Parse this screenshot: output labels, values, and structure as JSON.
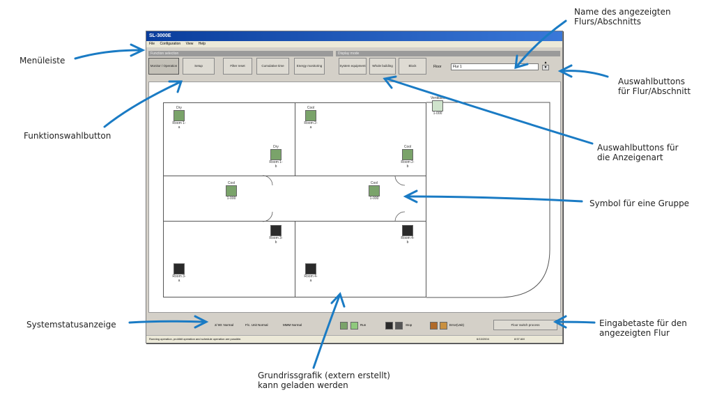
{
  "annotations": {
    "menu_bar": "Menüleiste",
    "function_button": "Funktionswahlbutton",
    "system_status": "Systemstatusanzeige",
    "floor_name_1": "Name des angezeigten",
    "floor_name_2": "Flurs/Abschnitts",
    "floor_select_1": "Auswahlbuttons",
    "floor_select_2": "für Flur/Abschnitt",
    "view_type_1": "Auswahlbuttons für",
    "view_type_2": "die Anzeigenart",
    "group_symbol": "Symbol für eine Gruppe",
    "enter_key_1": "Eingabetaste für den",
    "enter_key_2": "angezeigten Flur",
    "floorplan_1": "Grundrissgrafik (extern erstellt)",
    "floorplan_2": "kann geladen werden"
  },
  "window": {
    "title": "SL-3000E",
    "menu": [
      "File",
      "Configuration",
      "View",
      "Help"
    ],
    "group_left_header": "Function selection",
    "group_right_header": "Display mode",
    "function_buttons": [
      "Monitor / Operation",
      "Setup",
      "Filter reset",
      "Cumulative time",
      "Energy monitoring"
    ],
    "view_buttons": [
      "System equipment",
      "Whole building",
      "Block"
    ],
    "floor_label": "Floor",
    "floor_value": "Flur 1",
    "floor_spinner_up": "▲",
    "floor_spinner_down": "▼"
  },
  "units": [
    {
      "mode": "Dry",
      "label": "Room 1-a"
    },
    {
      "mode": "Cool",
      "label": "Room 2-a"
    },
    {
      "mode": "Dry",
      "label": "Room 1-b"
    },
    {
      "mode": "Cool",
      "label": "Room 2-b"
    },
    {
      "mode": "Cool",
      "label": "1-000"
    },
    {
      "mode": "Cool",
      "label": "1-000"
    },
    {
      "mode": "",
      "label": "Room 3-b"
    },
    {
      "mode": "",
      "label": "Room 4-b"
    },
    {
      "mode": "",
      "label": "Room 3-a"
    },
    {
      "mode": "",
      "label": "Room 4-a"
    },
    {
      "mode": "Ventilation",
      "label": "1-000"
    }
  ],
  "status": {
    "s1": "2/ 80: Normal",
    "s2": "F/c. Unit Normal",
    "s3": "MMM Normal",
    "run": "Run",
    "stop": "Stop",
    "error": "Error(Unit)",
    "enter_button": "Floor switch process",
    "bottom_text": "Running operation, prohibit operation and schedule operation are possible.",
    "date": "6/13/2004",
    "time": "8:57 AM"
  },
  "colors": {
    "arrow": "#1a7bc4",
    "title_bar": "#0a3d9c",
    "unit_green": "#7aa36a",
    "unit_dark": "#2a2a2a"
  }
}
